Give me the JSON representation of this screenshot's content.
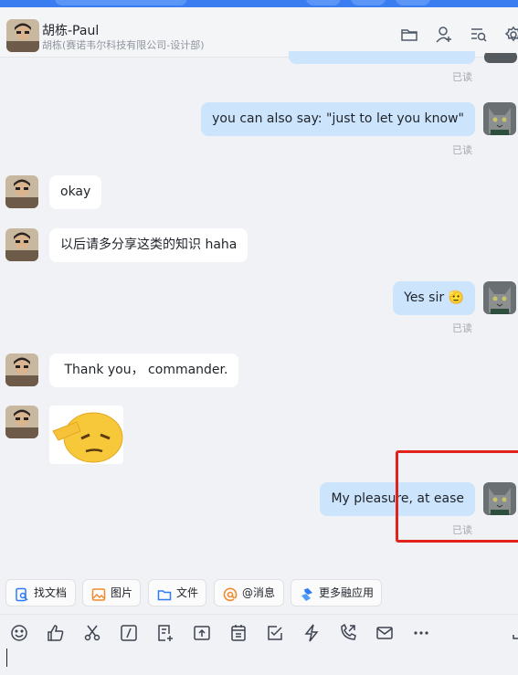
{
  "header": {
    "contact_name": "胡栋-Paul",
    "contact_subtitle": "胡栋(赛诺韦尔科技有限公司-设计部)",
    "icons": [
      "folder-icon",
      "add-member-icon",
      "search-history-icon",
      "settings-icon"
    ]
  },
  "messages": [
    {
      "from": "me",
      "text": "you can also say: \"just to let you know\"",
      "status": "已读"
    },
    {
      "from": "other",
      "text": "okay"
    },
    {
      "from": "other",
      "text": "以后请多分享这类的知识 haha"
    },
    {
      "from": "me",
      "text": "Yes sir 🫡",
      "status": "已读"
    },
    {
      "from": "other",
      "text": " Thank you， commander."
    },
    {
      "from": "other",
      "sticker": "salute-emoji-sticker"
    },
    {
      "from": "me",
      "text": "My pleasure, at ease",
      "status": "已读"
    }
  ],
  "top_read_status": "已读",
  "quick_actions": [
    {
      "label": "找文档",
      "icon": "find-doc-icon"
    },
    {
      "label": "图片",
      "icon": "image-icon"
    },
    {
      "label": "文件",
      "icon": "folder-icon"
    },
    {
      "label": "@消息",
      "icon": "at-icon"
    },
    {
      "label": "更多融应用",
      "icon": "apps-icon"
    }
  ],
  "toolbar": [
    "emoji-icon",
    "thumbs-up-icon",
    "scissors-icon",
    "slash-command-icon",
    "doc-add-icon",
    "upload-icon",
    "calendar-icon",
    "task-check-icon",
    "lightning-icon",
    "phone-icon",
    "mail-icon",
    "more-icon"
  ],
  "colors": {
    "my_bubble": "#cce5fd",
    "other_bubble": "#ffffff",
    "accent": "#3a7df0",
    "highlight": "#e3221b"
  }
}
